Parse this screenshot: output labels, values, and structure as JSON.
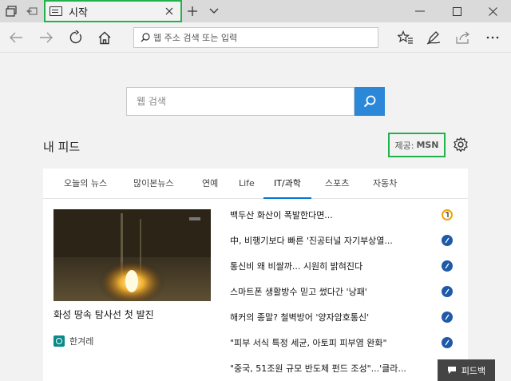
{
  "tab": {
    "title": "시작"
  },
  "address": {
    "placeholder": "웹 주소 검색 또는 입력"
  },
  "search": {
    "placeholder": "웹 검색"
  },
  "feed": {
    "title": "내 피드",
    "provider_prefix": "제공:",
    "provider_name": "MSN"
  },
  "categories": [
    "오늘의 뉴스",
    "많이본뉴스",
    "연예",
    "Life",
    "IT/과학",
    "스포츠",
    "자동차"
  ],
  "active_category": "IT/과학",
  "hero": {
    "caption": "화성 땅속 탐사선 첫 발진",
    "source": "한겨레"
  },
  "news": [
    {
      "title": "백두산 화산이 폭발한다면...",
      "source_icon": "yellow-source-icon"
    },
    {
      "title": "中, 비행기보다 빠른 '진공터널 자기부상열...",
      "source_icon": "blue-source-icon"
    },
    {
      "title": "통신비 왜 비쌀까... 시원히 밝혀진다",
      "source_icon": "blue-source-icon"
    },
    {
      "title": "스마트폰 생활방수 믿고 썼다간 '낭패'",
      "source_icon": "blue-source-icon"
    },
    {
      "title": "해커의 종말? 철벽방어 '양자암호통신'",
      "source_icon": "blue-source-icon"
    },
    {
      "title": "\"피부 서식 특정 세균, 아토피 피부염 완화\"",
      "source_icon": "blue-source-icon"
    },
    {
      "title": "\"중국, 51조원 규모 반도체 펀드 조성\"...'클라...",
      "source_icon": "blue-source-icon"
    }
  ],
  "feedback": {
    "label": "피드백"
  },
  "colors": {
    "accent": "#0078d7",
    "highlight_box": "#22b14c",
    "search_button": "#2b88d8"
  }
}
